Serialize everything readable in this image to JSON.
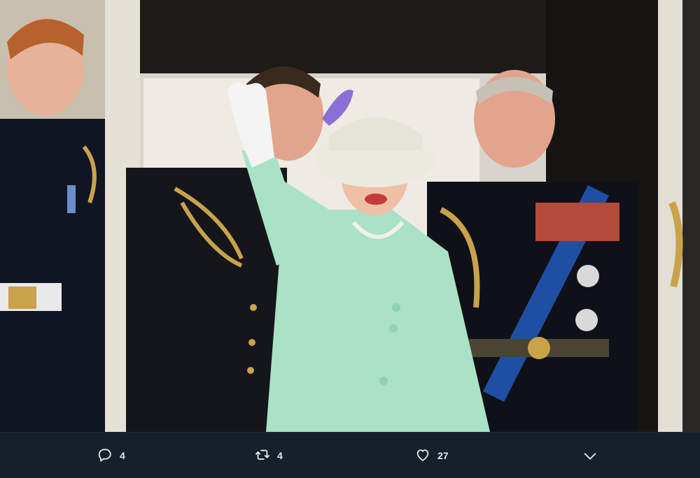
{
  "tweet_photo": {
    "subject": "royal-family-balcony-photo"
  },
  "actions": {
    "reply": {
      "icon": "reply-icon",
      "count": "4"
    },
    "retweet": {
      "icon": "retweet-icon",
      "count": "4"
    },
    "like": {
      "icon": "heart-icon",
      "count": "27"
    },
    "more": {
      "icon": "chevron-down-icon"
    }
  },
  "colors": {
    "background": "#15202b",
    "text": "#e1e8ed"
  }
}
